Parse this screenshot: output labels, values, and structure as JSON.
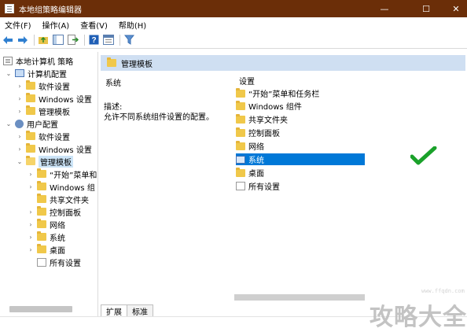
{
  "window": {
    "title": "本地组策略编辑器",
    "controls": [
      "—",
      "☐",
      "✕"
    ]
  },
  "menu": [
    "文件(F)",
    "操作(A)",
    "查看(V)",
    "帮助(H)"
  ],
  "toolbar": {
    "icons": [
      "back-arrow-icon",
      "forward-arrow-icon",
      "up-folder-icon",
      "show-hide-tree-icon",
      "export-list-icon",
      "help-icon",
      "properties-icon",
      "filter-icon"
    ]
  },
  "tree": {
    "root": "本地计算机 策略",
    "computer_config": "计算机配置",
    "computer_children": [
      "软件设置",
      "Windows 设置",
      "管理模板"
    ],
    "user_config": "用户配置",
    "user_children": [
      "软件设置",
      "Windows 设置",
      "管理模板"
    ],
    "admin_children": [
      "“开始”菜单和",
      "Windows 组",
      "共享文件夹",
      "控制面板",
      "网络",
      "系统",
      "桌面",
      "所有设置"
    ]
  },
  "right": {
    "header": "管理模板",
    "selected_title": "系统",
    "desc_label": "描述:",
    "desc_text": "允许不同系统组件设置的配置。",
    "column": "设置",
    "items": [
      "“开始”菜单和任务栏",
      "Windows 组件",
      "共享文件夹",
      "控制面板",
      "网络",
      "系统",
      "桌面",
      "所有设置"
    ],
    "selected_item": "系统"
  },
  "tabs": [
    "扩展",
    "标准"
  ],
  "watermark": {
    "text": "攻略大全",
    "url": "www.ffqdn.com"
  },
  "colors": {
    "titlebar": "#6b2e08",
    "selection": "#0078d7",
    "header": "#cfdff2",
    "folder": "#f0c84a",
    "check": "#1aa12a"
  }
}
